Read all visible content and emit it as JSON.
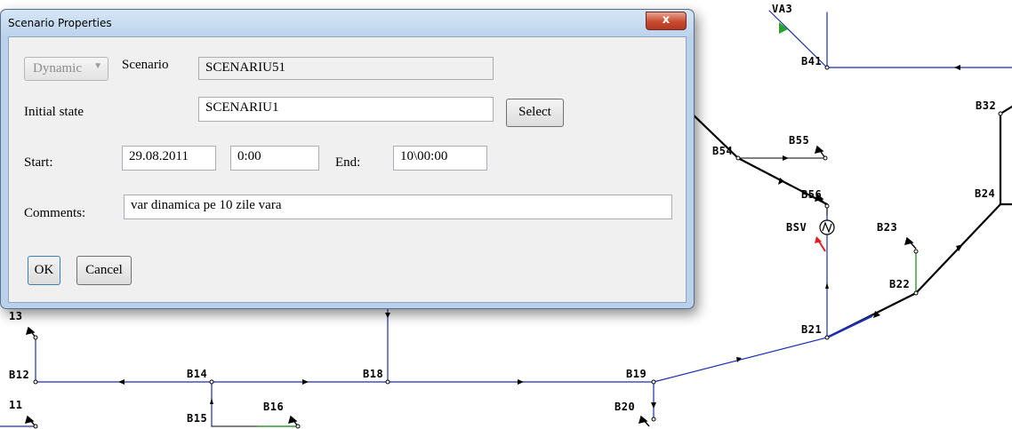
{
  "dialog": {
    "title": "Scenario Properties",
    "close_glyph": "x",
    "mode_select": {
      "value": "Dynamic",
      "arrow_icon": "chevron-down-icon"
    },
    "scenario_label": "Scenario",
    "scenario_value": "SCENARIU51",
    "initial_state_label": "Initial state",
    "initial_state_value": "SCENARIU1",
    "select_button": "Select",
    "start_label": "Start:",
    "start_date": "29.08.2011",
    "start_time": "0:00",
    "end_label": "End:",
    "end_value": "10\\00:00",
    "comments_label": "Comments:",
    "comments_value": "var dinamica pe 10 zile vara",
    "ok_button": "OK",
    "cancel_button": "Cancel"
  },
  "network": {
    "colors": {
      "line": "#1c2fb0",
      "thick": "#000000",
      "green": "#2e9a2e",
      "red": "#e02020"
    },
    "bus_labels": {
      "top_clipped": "VA3",
      "b41": "B41",
      "b32": "B32",
      "b55": "B55",
      "b54": "B54",
      "b56": "B56",
      "b24": "B24",
      "bsv": "BSV",
      "b23": "B23",
      "b22": "B22",
      "b13": "13",
      "b21": "B21",
      "b12": "B12",
      "b14": "B14",
      "b18": "B18",
      "b19": "B19",
      "b11": "11",
      "b20": "B20",
      "b15": "B15",
      "b16": "B16"
    }
  }
}
